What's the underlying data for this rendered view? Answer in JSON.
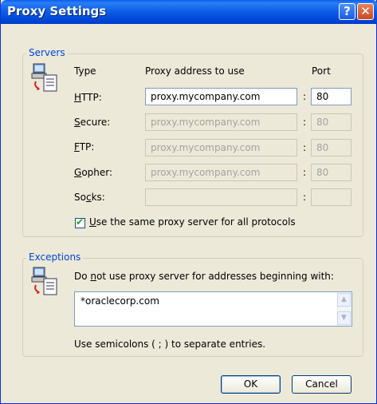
{
  "window": {
    "title": "Proxy Settings",
    "help_label": "?",
    "close_label": "✕"
  },
  "servers": {
    "group_label": "Servers",
    "icon": "network-computers-icon",
    "col_type": "Type",
    "col_address": "Proxy address to use",
    "col_port": "Port",
    "rows": [
      {
        "hot": "H",
        "rest": "TTP:",
        "address": "proxy.mycompany.com",
        "port": "80",
        "enabled": true
      },
      {
        "hot": "S",
        "rest": "ecure:",
        "address": "proxy.mycompany.com",
        "port": "80",
        "enabled": false
      },
      {
        "hot": "F",
        "rest": "TP:",
        "address": "proxy.mycompany.com",
        "port": "80",
        "enabled": false
      },
      {
        "hot": "G",
        "rest": "opher:",
        "address": "proxy.mycompany.com",
        "port": "80",
        "enabled": false
      },
      {
        "pre": "So",
        "hot": "c",
        "rest": "ks:",
        "address": "",
        "port": "",
        "enabled": false
      }
    ],
    "colon": ":",
    "same_proxy": {
      "hot": "U",
      "rest": "se the same proxy server for all protocols",
      "checked": true
    }
  },
  "exceptions": {
    "group_label": "Exceptions",
    "icon": "network-computers-icon",
    "instruction_pre": "Do ",
    "instruction_hot": "n",
    "instruction_rest": "ot use proxy server for addresses beginning with:",
    "value": "*oraclecorp.com",
    "hint": "Use semicolons ( ; ) to separate entries."
  },
  "buttons": {
    "ok": "OK",
    "cancel": "Cancel"
  }
}
